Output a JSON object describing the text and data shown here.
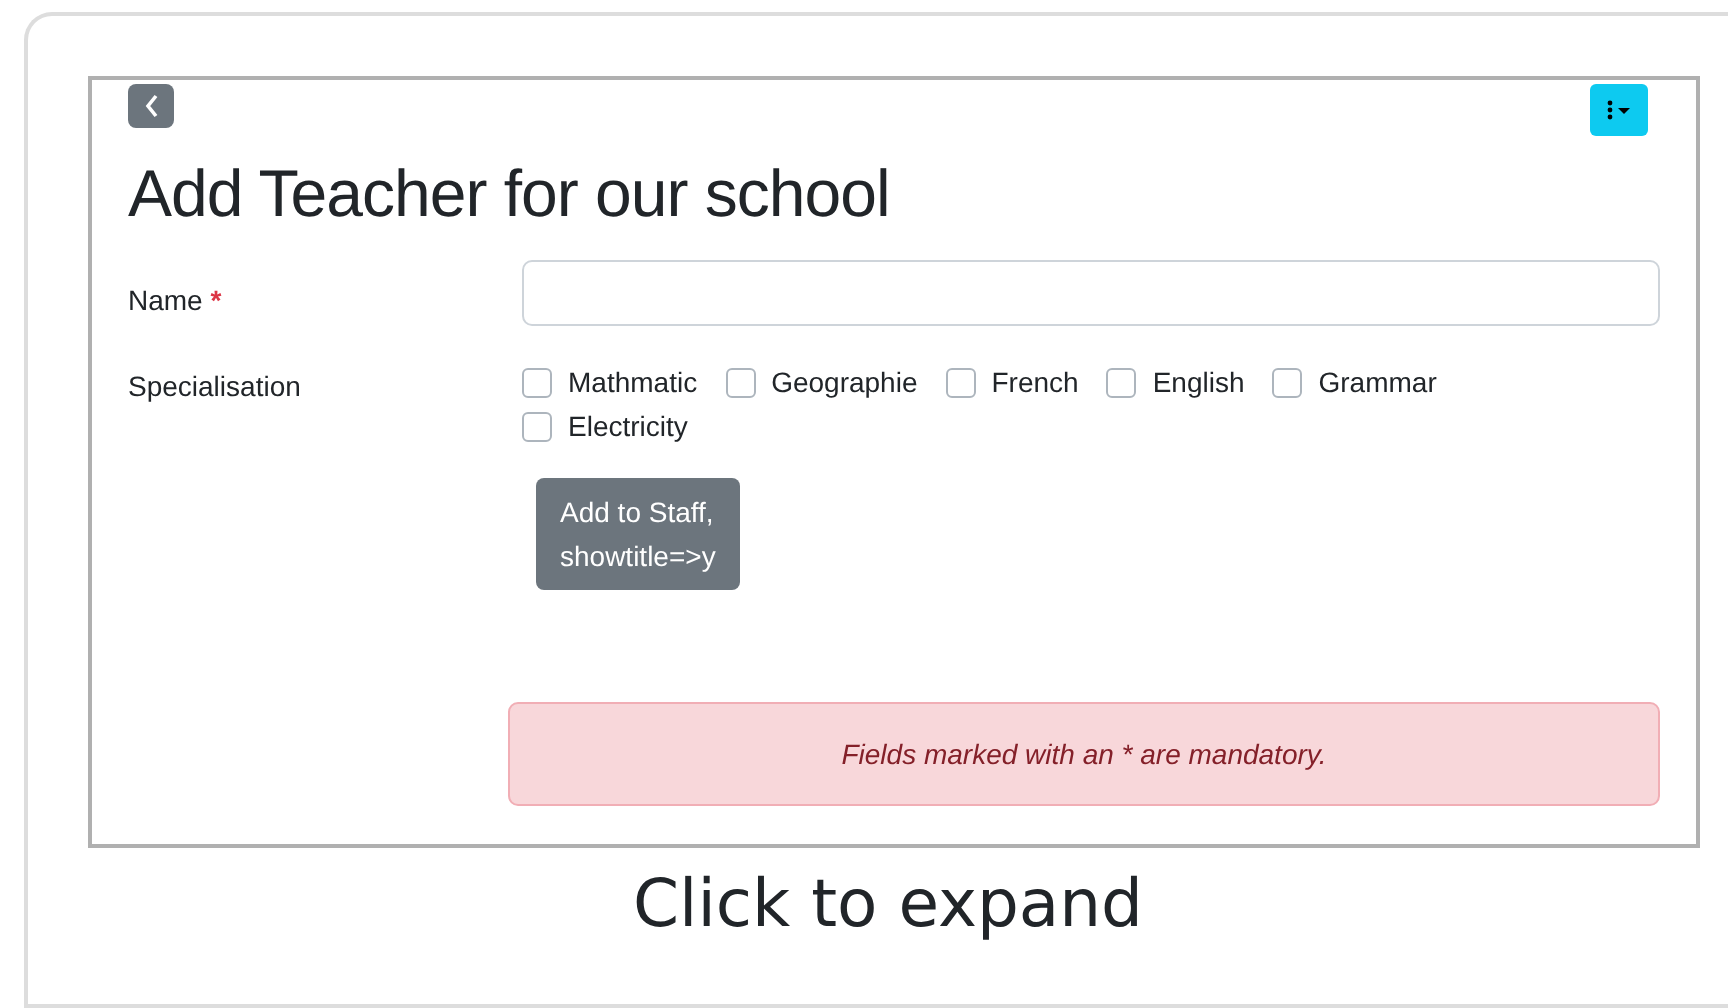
{
  "page": {
    "title": "Add Teacher for our school"
  },
  "form": {
    "name_label": "Name",
    "required_mark": "*",
    "specialisation_label": "Specialisation",
    "options": [
      {
        "label": "Mathmatic",
        "checked": false
      },
      {
        "label": "Geographie",
        "checked": false
      },
      {
        "label": "French",
        "checked": false
      },
      {
        "label": "English",
        "checked": false
      },
      {
        "label": "Grammar",
        "checked": false
      },
      {
        "label": "Electricity",
        "checked": false
      }
    ],
    "submit_lines": [
      "Add to Staff,",
      "showtitle=>y"
    ],
    "notice": "Fields marked with an * are mandatory."
  },
  "caption": "Click to expand"
}
